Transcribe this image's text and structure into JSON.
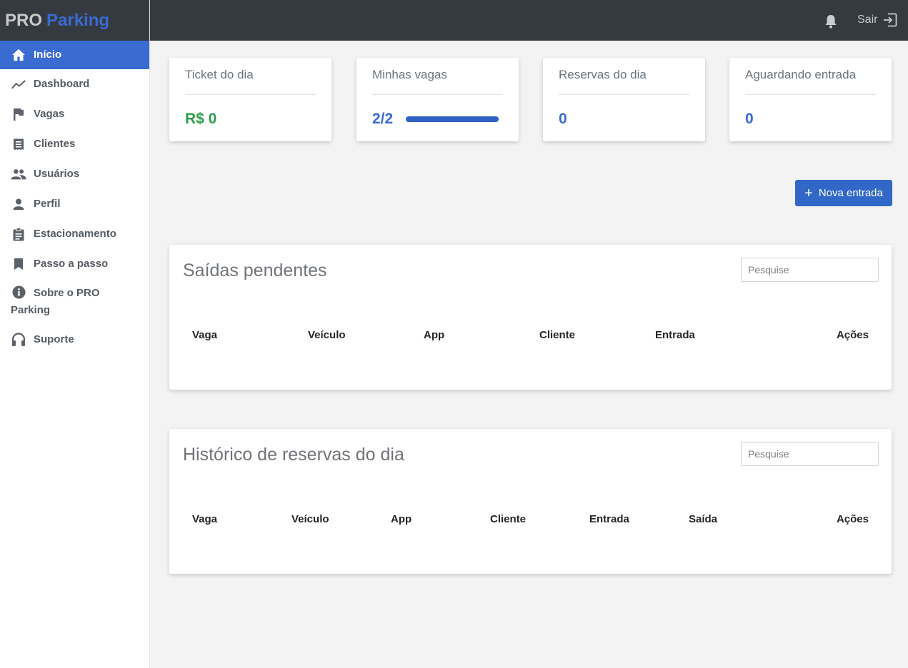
{
  "brand": {
    "pro": "PRO",
    "parking": "Parking"
  },
  "sidebar": {
    "items": [
      {
        "label": "Início",
        "icon": "home-icon",
        "active": true
      },
      {
        "label": "Dashboard",
        "icon": "trend-icon"
      },
      {
        "label": "Vagas",
        "icon": "flag-icon"
      },
      {
        "label": "Clientes",
        "icon": "receipt-icon"
      },
      {
        "label": "Usuários",
        "icon": "people-icon"
      },
      {
        "label": "Perfil",
        "icon": "person-icon"
      },
      {
        "label": "Estacionamento",
        "icon": "clipboard-icon"
      },
      {
        "label": "Passo a passo",
        "icon": "bookmark-icon"
      },
      {
        "label": "Sobre o PRO Parking",
        "icon": "info-icon"
      },
      {
        "label": "Suporte",
        "icon": "headset-icon"
      }
    ]
  },
  "topbar": {
    "logout_label": "Sair"
  },
  "stats": [
    {
      "title": "Ticket do dia",
      "value": "R$ 0"
    },
    {
      "title": "Minhas vagas",
      "value": "2/2",
      "progress": 1.0
    },
    {
      "title": "Reservas do dia",
      "value": "0"
    },
    {
      "title": "Aguardando entrada",
      "value": "0"
    }
  ],
  "new_entry_label": "Nova entrada",
  "pending_exits": {
    "title": "Saídas pendentes",
    "search_placeholder": "Pesquise",
    "columns": [
      "Vaga",
      "Veículo",
      "App",
      "Cliente",
      "Entrada",
      "Ações"
    ]
  },
  "history": {
    "title": "Histórico de reservas do dia",
    "search_placeholder": "Pesquise",
    "columns": [
      "Vaga",
      "Veículo",
      "App",
      "Cliente",
      "Entrada",
      "Saída",
      "Ações"
    ]
  },
  "colors": {
    "accent": "#3a6bd1",
    "green": "#2e9e4c",
    "topbar": "#343a40"
  }
}
